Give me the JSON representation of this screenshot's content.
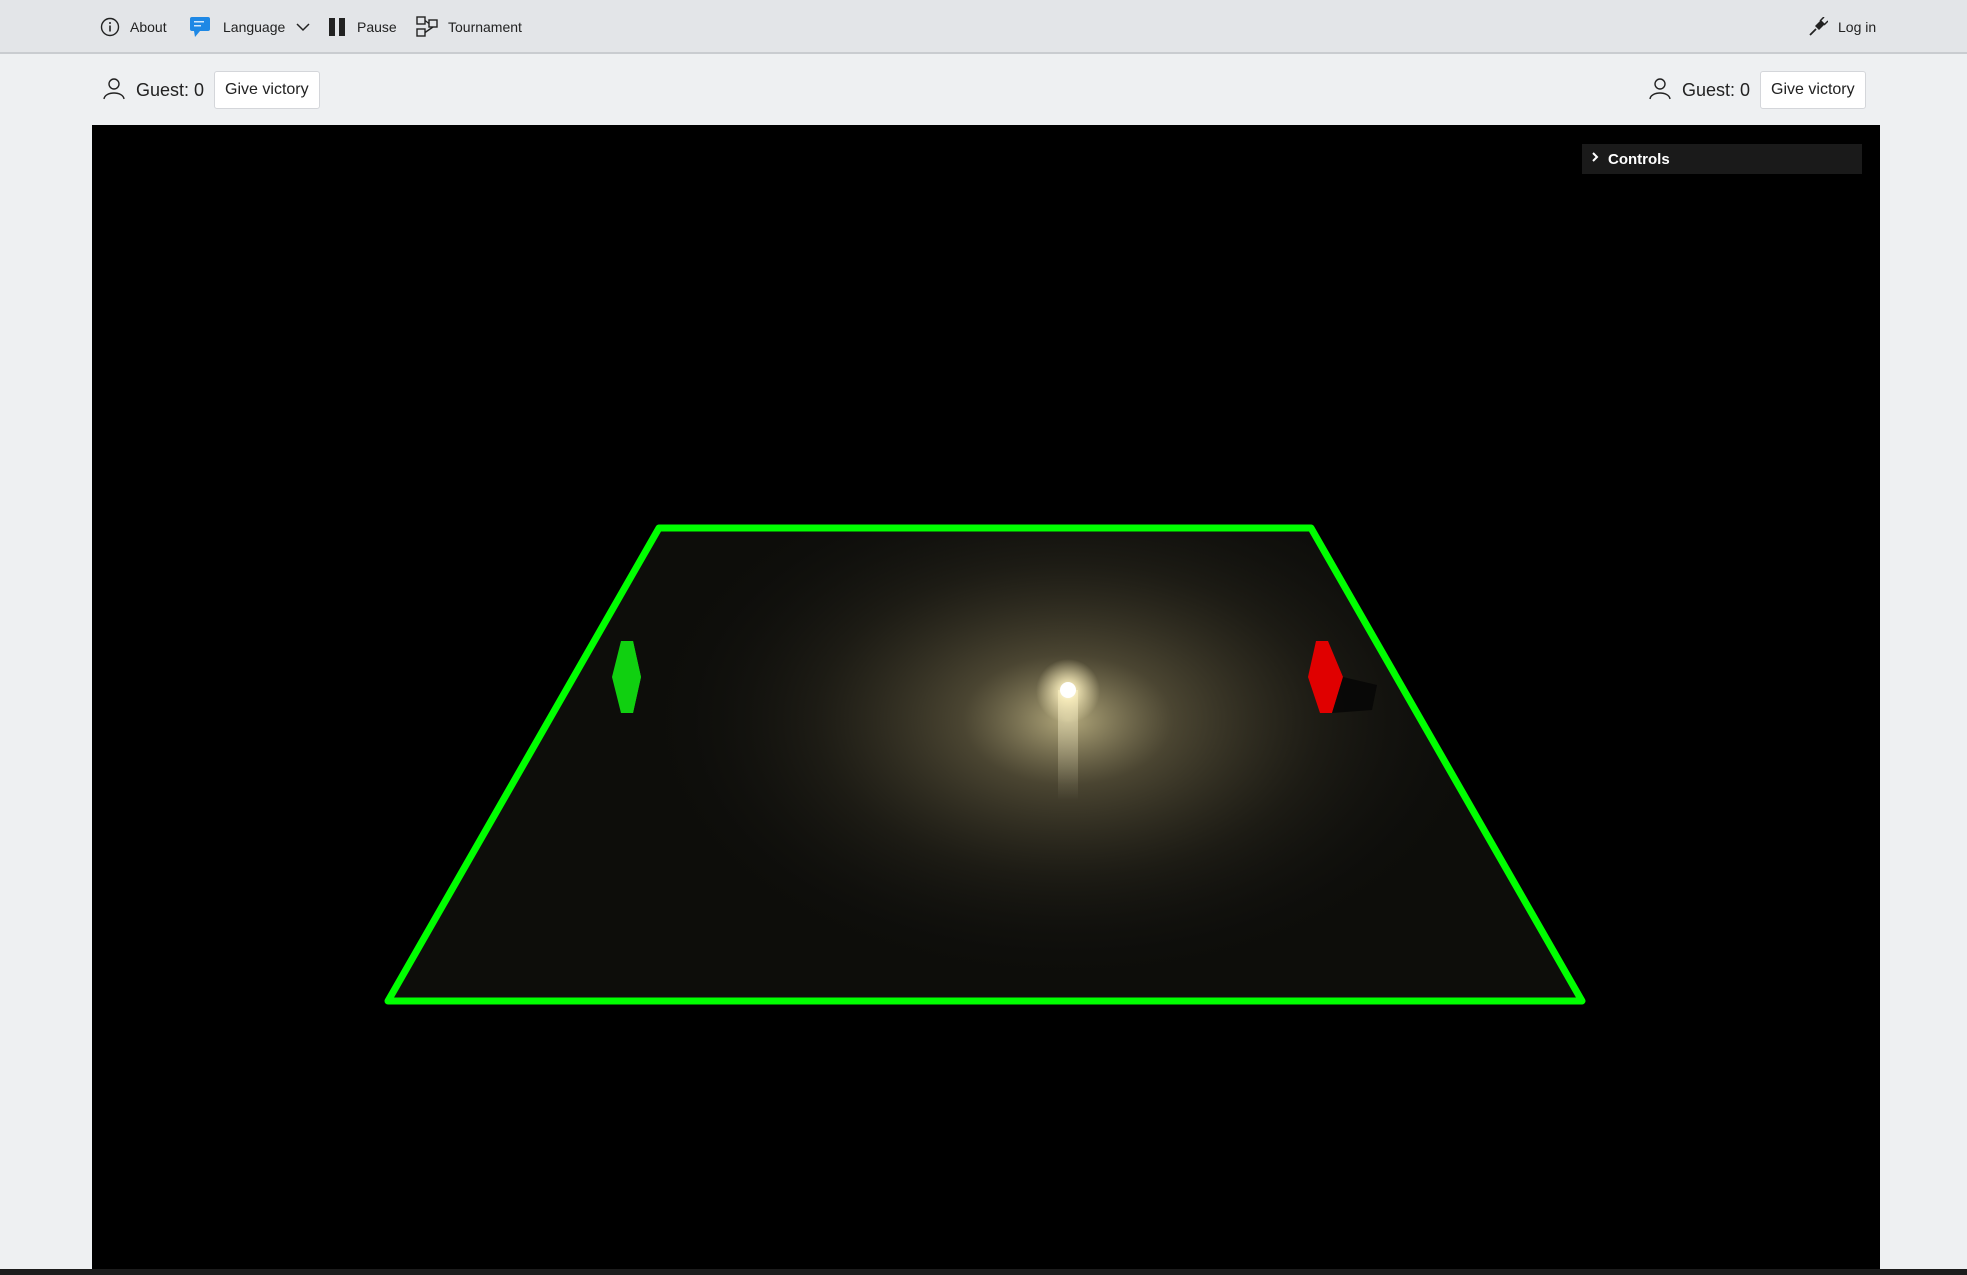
{
  "nav": {
    "about_label": "About",
    "language_label": "Language",
    "pause_label": "Pause",
    "tournament_label": "Tournament",
    "login_label": "Log in"
  },
  "players": {
    "left": {
      "label": "Guest: 0",
      "victory_label": "Give victory"
    },
    "right": {
      "label": "Guest: 0",
      "victory_label": "Give victory"
    }
  },
  "game": {
    "controls_label": "Controls",
    "colors": {
      "field_border": "#00ff00",
      "left_paddle": "#10d010",
      "right_paddle": "#e00000",
      "ball": "#fffbe8",
      "background": "#000000"
    }
  }
}
